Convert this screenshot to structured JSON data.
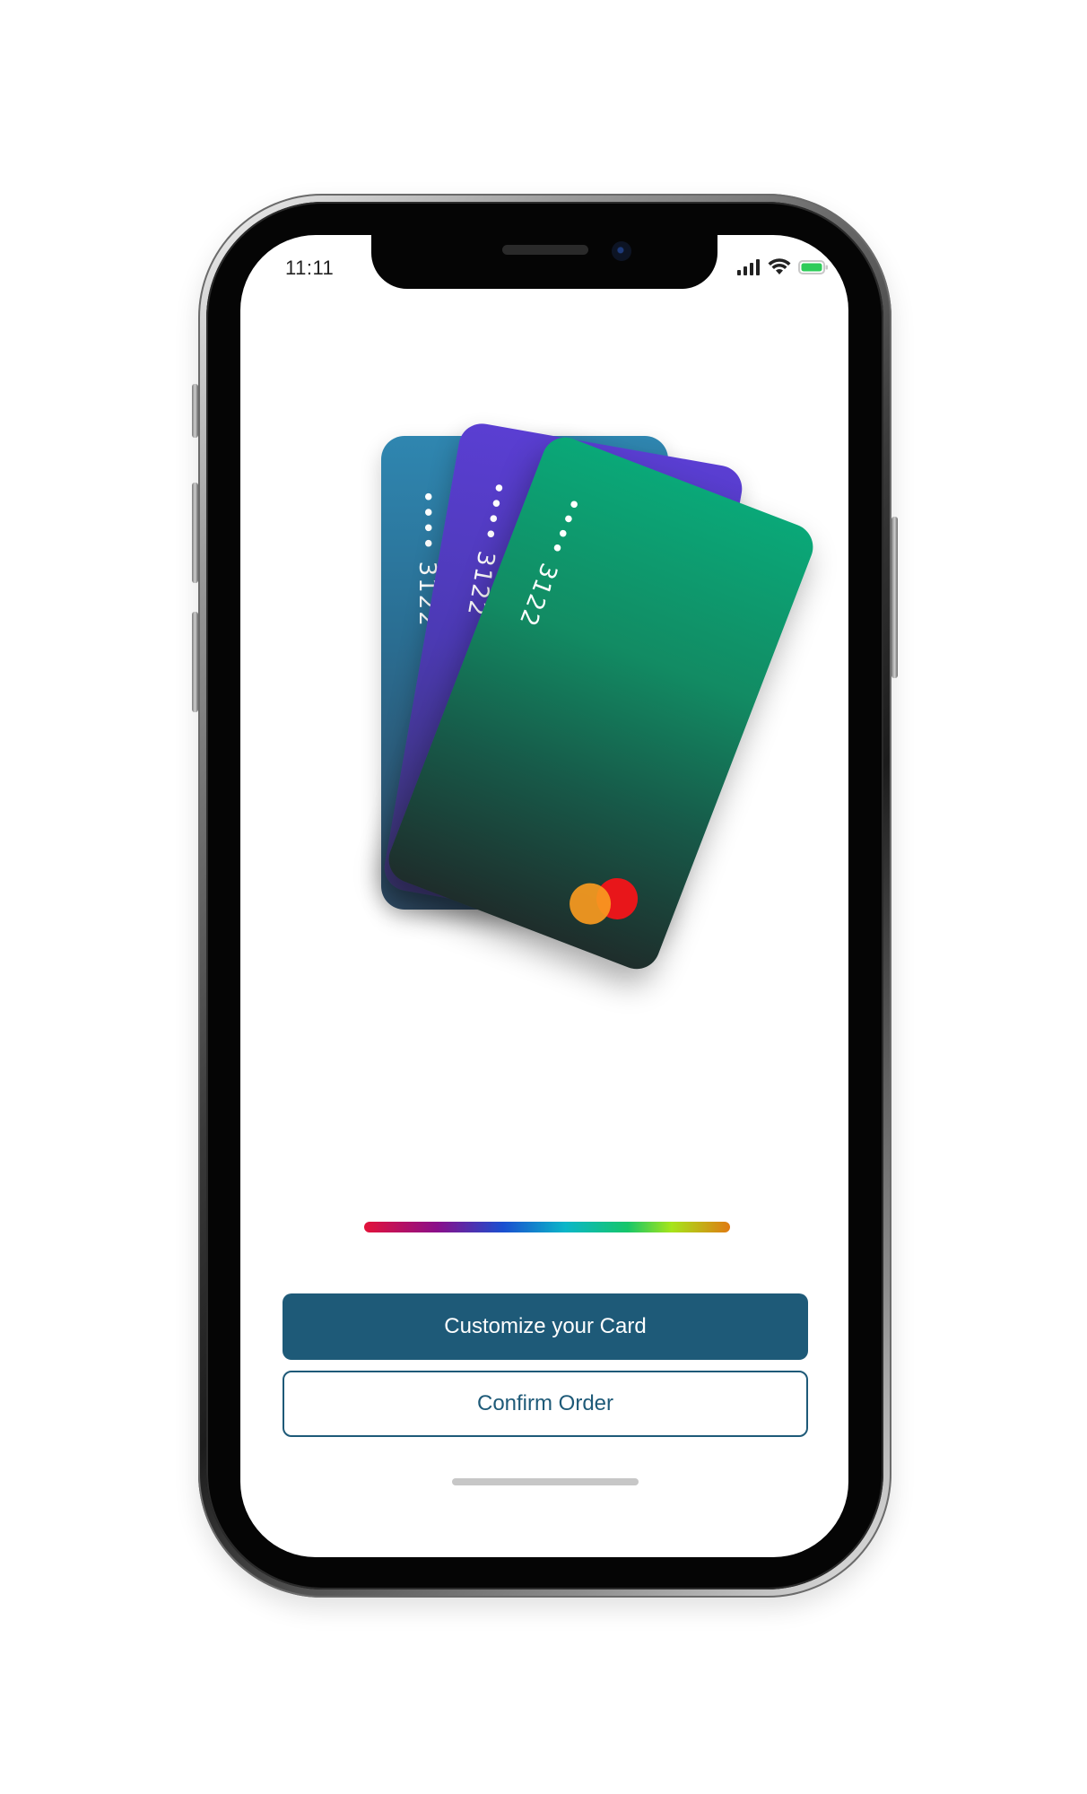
{
  "status_bar": {
    "time": "11:11",
    "icons": [
      "signal-icon",
      "wifi-icon",
      "battery-icon"
    ]
  },
  "cards": [
    {
      "name": "card-back",
      "color": "#2f86b0",
      "number": "•••• 3122"
    },
    {
      "name": "card-mid",
      "color": "#5a3ed2",
      "number": "•••• 3122"
    },
    {
      "name": "card-front",
      "color": "#0aa878",
      "number": "•••• 3122",
      "brand_icon": "mastercard-logo"
    }
  ],
  "color_picker": {
    "colors": [
      "#e3123a",
      "#8a0f8a",
      "#1a4fd0",
      "#0bb6c8",
      "#16c66a",
      "#a6e51a",
      "#e07a12"
    ]
  },
  "actions": {
    "customize_label": "Customize your Card",
    "confirm_label": "Confirm Order"
  },
  "theme": {
    "accent": "#1e5a78",
    "battery": "#2ecc5a"
  }
}
